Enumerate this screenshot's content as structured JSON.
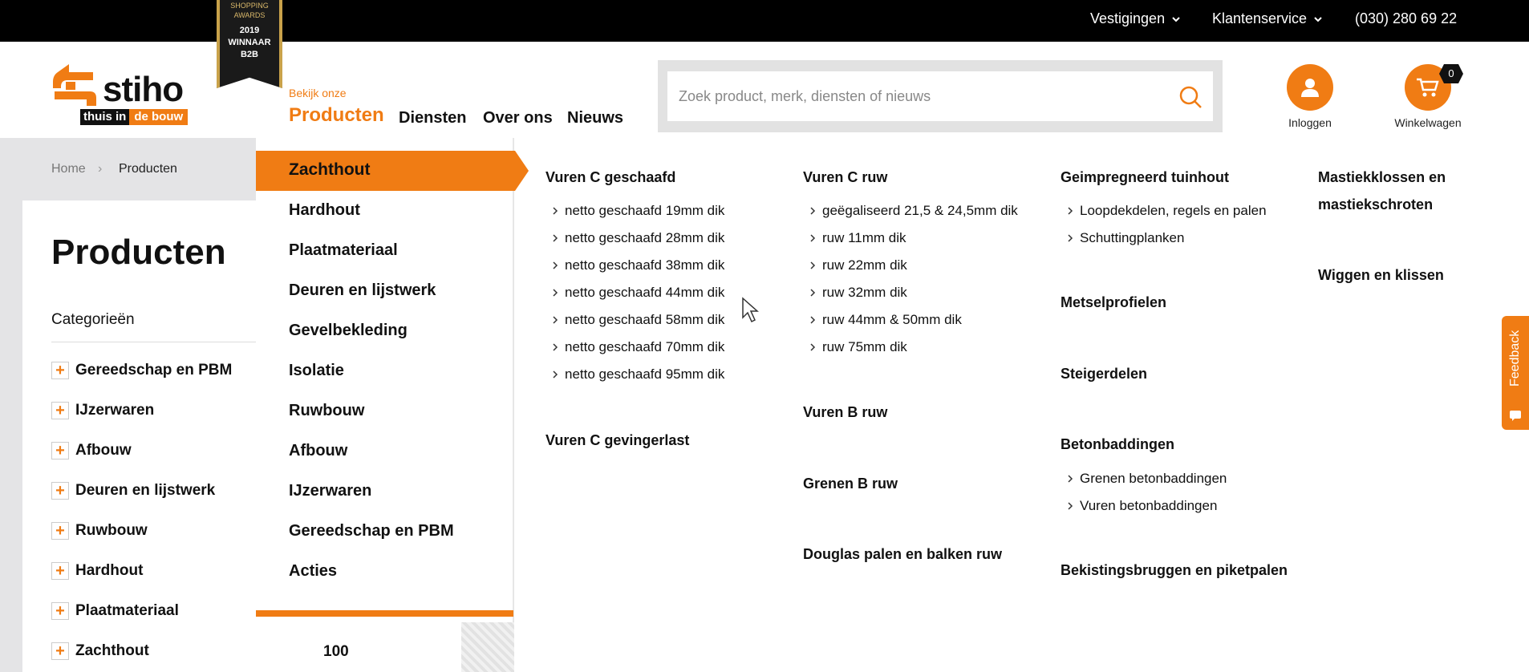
{
  "topbar": {
    "vestigingen": "Vestigingen",
    "klantenservice": "Klantenservice",
    "phone": "(030) 280 69 22"
  },
  "award": {
    "line1": "SHOPPING",
    "line2": "AWARDS",
    "year": "2019",
    "win": "WINNAAR",
    "cat": "B2B"
  },
  "logo": {
    "word": "stiho",
    "tag_a": "thuis in",
    "tag_b": "de bouw"
  },
  "nav": {
    "kicker": "Bekijk onze",
    "products": "Producten",
    "diensten": "Diensten",
    "over_ons": "Over ons",
    "nieuws": "Nieuws"
  },
  "search": {
    "placeholder": "Zoek product, merk, diensten of nieuws"
  },
  "account": {
    "login": "Inloggen",
    "cart": "Winkelwagen",
    "cart_count": "0"
  },
  "breadcrumb": {
    "home": "Home",
    "sep": "›",
    "current": "Producten"
  },
  "page": {
    "title": "Producten",
    "categories_title": "Categorieën",
    "categories": [
      "Gereedschap en PBM",
      "IJzerwaren",
      "Afbouw",
      "Deuren en lijstwerk",
      "Ruwbouw",
      "Hardhout",
      "Plaatmateriaal",
      "Zachthout"
    ]
  },
  "mega": {
    "main": [
      "Zachthout",
      "Hardhout",
      "Plaatmateriaal",
      "Deuren en lijstwerk",
      "Gevelbekleding",
      "Isolatie",
      "Ruwbouw",
      "Afbouw",
      "IJzerwaren",
      "Gereedschap en PBM",
      "Acties"
    ],
    "number": "100",
    "col1": {
      "head1": "Vuren C geschaafd",
      "items1": [
        "netto geschaafd 19mm dik",
        "netto geschaafd 28mm dik",
        "netto geschaafd 38mm dik",
        "netto geschaafd 44mm dik",
        "netto geschaafd 58mm dik",
        "netto geschaafd 70mm dik",
        "netto geschaafd 95mm dik"
      ],
      "head2": "Vuren C gevingerlast"
    },
    "col2": {
      "head1": "Vuren C ruw",
      "items1": [
        "geëgaliseerd 21,5 & 24,5mm dik",
        "ruw 11mm dik",
        "ruw 22mm dik",
        "ruw 32mm dik",
        "ruw 44mm & 50mm dik",
        "ruw 75mm dik"
      ],
      "head2": "Vuren B ruw",
      "head3": "Grenen B ruw",
      "head4": "Douglas palen en balken ruw"
    },
    "col3": {
      "head1": "Geimpregneerd tuinhout",
      "items1": [
        "Loopdekdelen, regels en palen",
        "Schuttingplanken"
      ],
      "head2": "Metselprofielen",
      "head3": "Steigerdelen",
      "head4": "Betonbaddingen",
      "items4": [
        "Grenen betonbaddingen",
        "Vuren betonbaddingen"
      ],
      "head5": "Bekistingsbruggen en piketpalen"
    },
    "col4": {
      "head1a": "Mastiekklossen en",
      "head1b": "mastiekschroten",
      "head2": "Wiggen en klissen"
    }
  },
  "feedback": {
    "label": "Feedback"
  },
  "colors": {
    "accent": "#f07c14",
    "topbar": "#000000",
    "panel_grey": "#e4e4e6"
  }
}
